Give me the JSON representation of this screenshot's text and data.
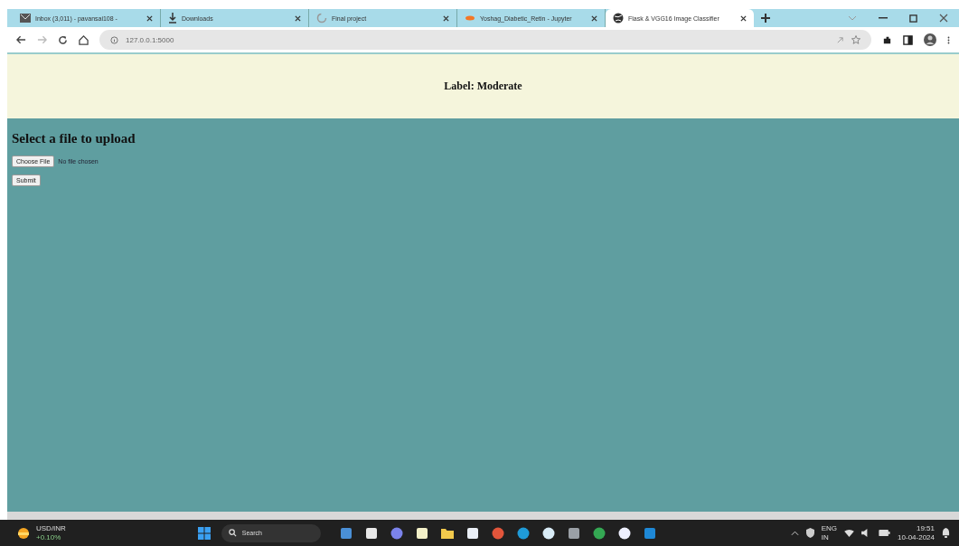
{
  "tabs": [
    {
      "title": "Inbox (3,011) - pavansai108 -",
      "selected": false,
      "kind": "mail"
    },
    {
      "title": "Downloads",
      "selected": false,
      "kind": "download"
    },
    {
      "title": "Final project",
      "selected": false,
      "kind": "loading"
    },
    {
      "title": "Yoshag_Diabetic_Retin - Jupyter",
      "selected": false,
      "kind": "jupyter"
    },
    {
      "title": "Flask & VGG16 Image Classifier",
      "selected": true,
      "kind": "globe"
    }
  ],
  "address_bar": {
    "url": "127.0.0.1:5000"
  },
  "page": {
    "label": "Label: Moderate",
    "heading": "Select a file to upload",
    "file_button": "Choose File",
    "file_status": "No file chosen",
    "submit": "Submit"
  },
  "taskbar": {
    "weather_title": "USD/INR",
    "weather_sub": "+0.10%",
    "search": "Search",
    "lang_top": "ENG",
    "lang_bottom": "IN",
    "time": "19:51",
    "date": "10-04-2024",
    "apps": [
      {
        "kind": "square",
        "color": "#4a8fd6"
      },
      {
        "kind": "square",
        "color": "#e8e8e8"
      },
      {
        "kind": "circle",
        "color": "#7b83eb"
      },
      {
        "kind": "square",
        "color": "#f3f0c8"
      },
      {
        "kind": "folder",
        "color": "#f2c94c"
      },
      {
        "kind": "square",
        "color": "#e9eef5"
      },
      {
        "kind": "circle",
        "color": "#e2553b"
      },
      {
        "kind": "circle",
        "color": "#1f9bd8"
      },
      {
        "kind": "circle",
        "color": "#d9ecf7"
      },
      {
        "kind": "square",
        "color": "#9aa0a6"
      },
      {
        "kind": "circle",
        "color": "#34a853"
      },
      {
        "kind": "circle",
        "color": "#eef0ff"
      },
      {
        "kind": "square",
        "color": "#1e88d6"
      }
    ]
  }
}
